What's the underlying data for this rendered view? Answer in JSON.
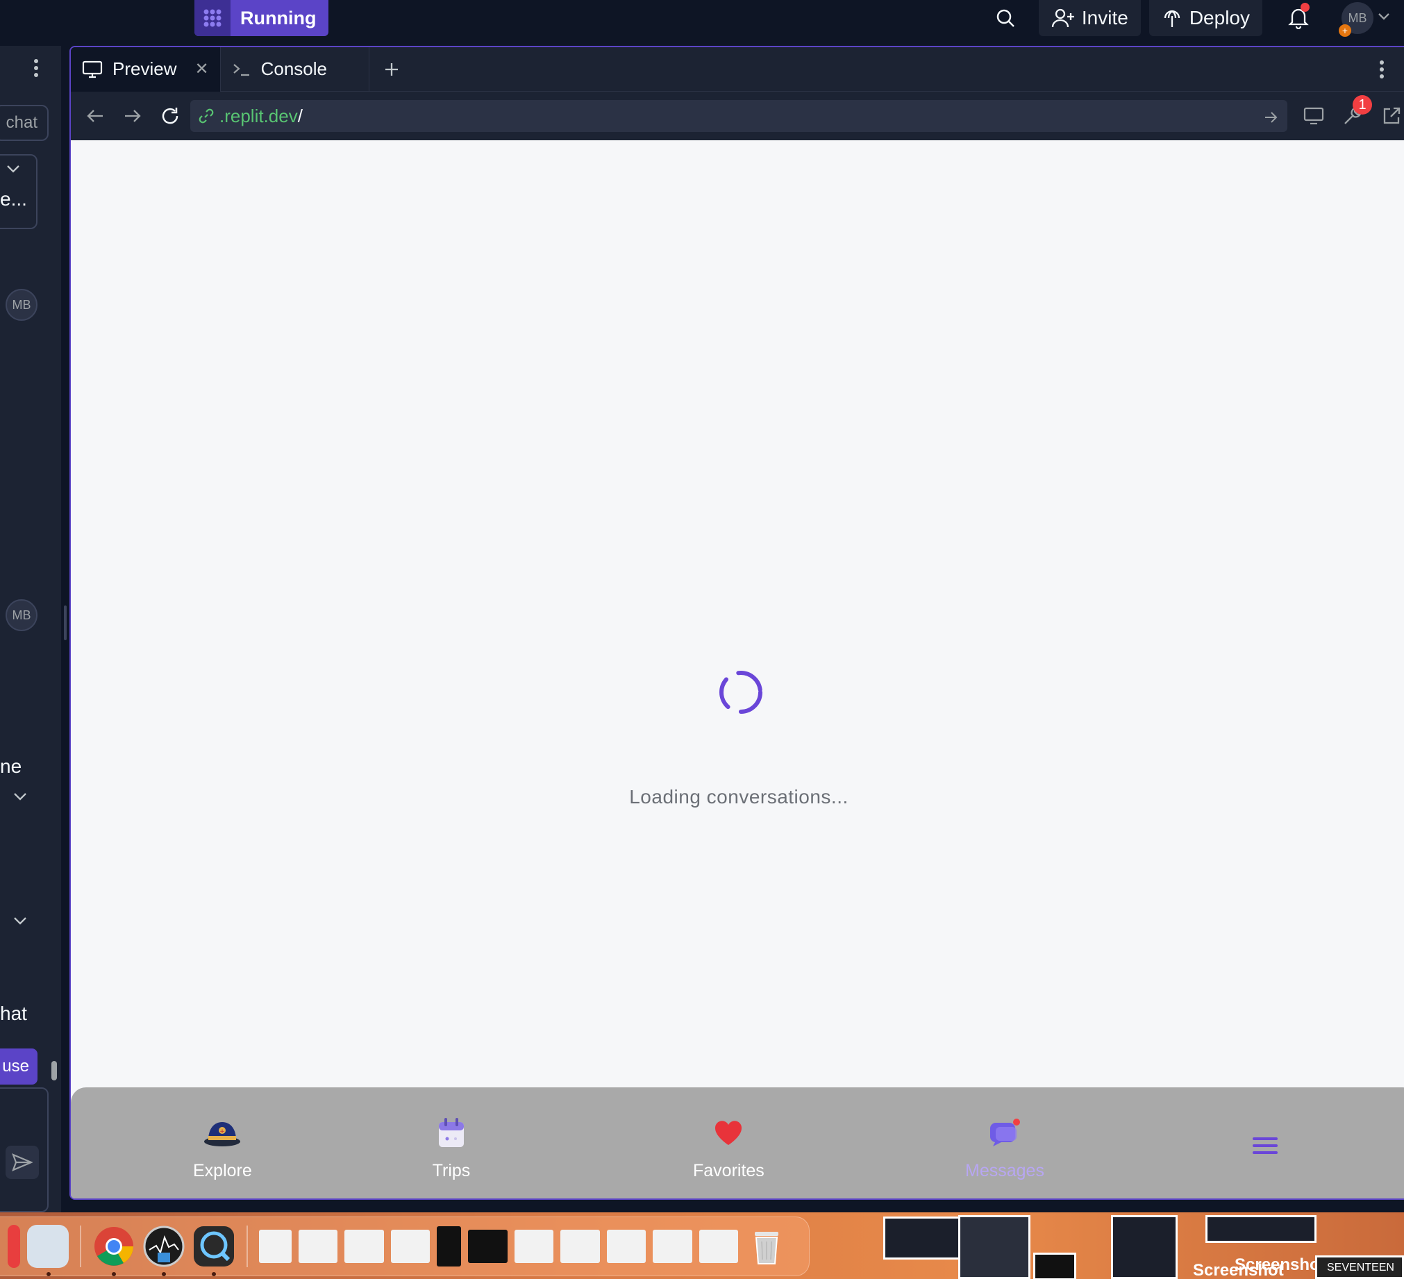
{
  "topbar": {
    "run_label": "Running",
    "invite_label": "Invite",
    "deploy_label": "Deploy",
    "avatar_initials": "MB"
  },
  "sidebar": {
    "chat_button": "chat",
    "card_text": "e...",
    "avatar1": "MB",
    "avatar2": "MB",
    "text_ne": "ne",
    "text_hat": "hat",
    "use_button": "use"
  },
  "pane": {
    "tabs": [
      {
        "label": "Preview",
        "icon": "monitor-icon",
        "active": true
      },
      {
        "label": "Console",
        "icon": "terminal-icon",
        "active": false
      }
    ],
    "url_domain": ".replit.dev",
    "url_path": "/",
    "devtools_badge": "1"
  },
  "app": {
    "loading_text": "Loading conversations...",
    "nav": [
      {
        "label": "Explore",
        "icon": "explorer-hat-icon"
      },
      {
        "label": "Trips",
        "icon": "calendar-icon"
      },
      {
        "label": "Favorites",
        "icon": "heart-icon"
      },
      {
        "label": "Messages",
        "icon": "chat-bubble-icon",
        "active": true
      }
    ],
    "accent": "#6a46d8"
  },
  "desktop": {
    "screenshot_label_1": "Screenshot",
    "screenshot_label_2": "Screenshot",
    "thumb_label": "SEVENTEEN"
  }
}
